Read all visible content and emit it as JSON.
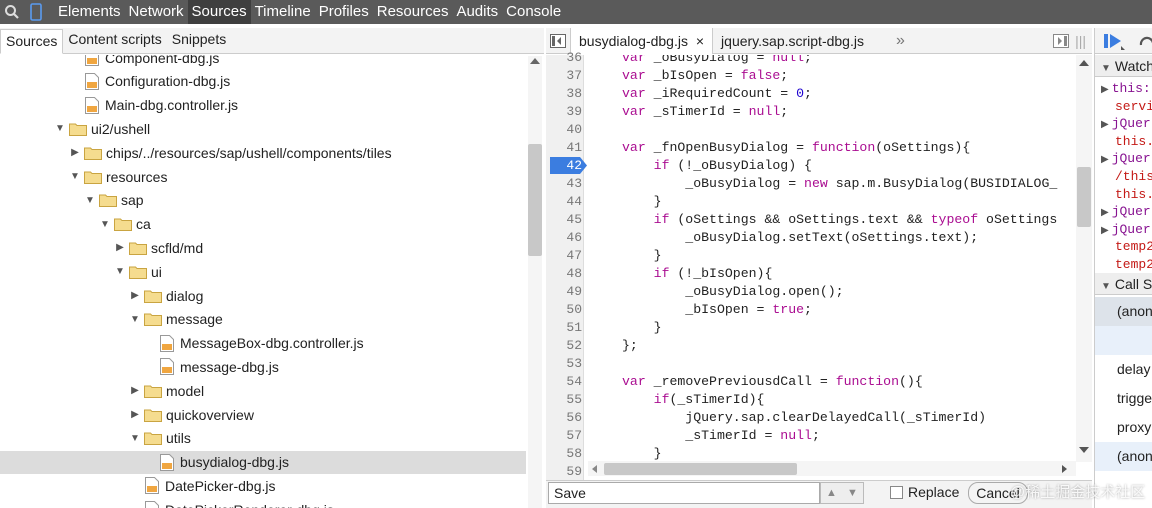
{
  "toolbar": {
    "search_icon": "magnifier-icon",
    "device_icon": "mobile-device-icon",
    "tabs": [
      "Elements",
      "Network",
      "Sources",
      "Timeline",
      "Profiles",
      "Resources",
      "Audits",
      "Console"
    ],
    "active_tab": "Sources"
  },
  "navigator": {
    "tabs": [
      "Sources",
      "Content scripts",
      "Snippets"
    ],
    "active_tab": "Sources",
    "tree": [
      {
        "label": "Component-dbg.js",
        "type": "file",
        "depth": 5
      },
      {
        "label": "Configuration-dbg.js",
        "type": "file",
        "depth": 5
      },
      {
        "label": "Main-dbg.controller.js",
        "type": "file",
        "depth": 5
      },
      {
        "label": "ui2/ushell",
        "type": "folder",
        "expanded": true,
        "depth": 3
      },
      {
        "label": "chips/../resources/sap/ushell/components/tiles",
        "type": "folder",
        "expanded": false,
        "depth": 4
      },
      {
        "label": "resources",
        "type": "folder",
        "expanded": true,
        "depth": 4
      },
      {
        "label": "sap",
        "type": "folder",
        "expanded": true,
        "depth": 5
      },
      {
        "label": "ca",
        "type": "folder",
        "expanded": true,
        "depth": 6
      },
      {
        "label": "scfld/md",
        "type": "folder",
        "expanded": false,
        "depth": 7
      },
      {
        "label": "ui",
        "type": "folder",
        "expanded": true,
        "depth": 7
      },
      {
        "label": "dialog",
        "type": "folder",
        "expanded": false,
        "depth": 8
      },
      {
        "label": "message",
        "type": "folder",
        "expanded": true,
        "depth": 8
      },
      {
        "label": "MessageBox-dbg.controller.js",
        "type": "file",
        "depth": 10
      },
      {
        "label": "message-dbg.js",
        "type": "file",
        "depth": 10
      },
      {
        "label": "model",
        "type": "folder",
        "expanded": false,
        "depth": 8
      },
      {
        "label": "quickoverview",
        "type": "folder",
        "expanded": false,
        "depth": 8
      },
      {
        "label": "utils",
        "type": "folder",
        "expanded": true,
        "depth": 8
      },
      {
        "label": "busydialog-dbg.js",
        "type": "file",
        "depth": 10,
        "selected": true
      },
      {
        "label": "DatePicker-dbg.js",
        "type": "file",
        "depth": 9
      },
      {
        "label": "DatePickerRenderer-dbg.js",
        "type": "file",
        "depth": 9
      }
    ]
  },
  "editor": {
    "tabs": [
      {
        "label": "busydialog-dbg.js",
        "active": true,
        "close": "×"
      },
      {
        "label": "jquery.sap.script-dbg.js",
        "active": false
      }
    ],
    "overflow_glyph": "»",
    "breakpoint_line": 42,
    "lines": [
      {
        "n": "36",
        "code": "var _oBusyDialog = null;"
      },
      {
        "n": "37",
        "code": "var _bIsOpen = false;"
      },
      {
        "n": "38",
        "code": "var _iRequiredCount = 0;"
      },
      {
        "n": "39",
        "code": "var _sTimerId = null;"
      },
      {
        "n": "40",
        "code": ""
      },
      {
        "n": "41",
        "code": "var _fnOpenBusyDialog = function(oSettings){"
      },
      {
        "n": "42",
        "code": "    if (!_oBusyDialog) {"
      },
      {
        "n": "43",
        "code": "        _oBusyDialog = new sap.m.BusyDialog(BUSIDIALOG_"
      },
      {
        "n": "44",
        "code": "    }"
      },
      {
        "n": "45",
        "code": "    if (oSettings && oSettings.text && typeof oSettings"
      },
      {
        "n": "46",
        "code": "        _oBusyDialog.setText(oSettings.text);"
      },
      {
        "n": "47",
        "code": "    }"
      },
      {
        "n": "48",
        "code": "    if (!_bIsOpen){"
      },
      {
        "n": "49",
        "code": "        _oBusyDialog.open();"
      },
      {
        "n": "50",
        "code": "        _bIsOpen = true;"
      },
      {
        "n": "51",
        "code": "    }"
      },
      {
        "n": "52",
        "code": "};"
      },
      {
        "n": "53",
        "code": ""
      },
      {
        "n": "54",
        "code": "var _removePreviousdCall = function(){"
      },
      {
        "n": "55",
        "code": "    if(_sTimerId){"
      },
      {
        "n": "56",
        "code": "        jQuery.sap.clearDelayedCall(_sTimerId)"
      },
      {
        "n": "57",
        "code": "        _sTimerId = null;"
      },
      {
        "n": "58",
        "code": "    }"
      },
      {
        "n": "59",
        "code": ""
      }
    ]
  },
  "search": {
    "value": "Save",
    "replace_label": "Replace",
    "cancel_label": "Cancel"
  },
  "debugger": {
    "watch_header": "Watch",
    "watch_lines": [
      {
        "text": "this:",
        "kind": "key",
        "arrow": true
      },
      {
        "text": "servi",
        "kind": "val",
        "arrow": false
      },
      {
        "text": "jQuer",
        "kind": "key",
        "arrow": true
      },
      {
        "text": "this.",
        "kind": "val",
        "arrow": false
      },
      {
        "text": "jQuer",
        "kind": "key",
        "arrow": true
      },
      {
        "text": "/this",
        "kind": "val",
        "arrow": false
      },
      {
        "text": "this.",
        "kind": "val",
        "arrow": false
      },
      {
        "text": "jQuer",
        "kind": "key",
        "arrow": true
      },
      {
        "text": "jQuer",
        "kind": "key",
        "arrow": true
      },
      {
        "text": "temp2",
        "kind": "val",
        "arrow": false
      },
      {
        "text": "temp2",
        "kind": "val",
        "arrow": false
      }
    ],
    "callstack_header": "Call S",
    "callstack": [
      {
        "label": "(anon",
        "style": "selected"
      },
      {
        "label": "",
        "style": "light"
      },
      {
        "label": "delay",
        "style": ""
      },
      {
        "label": "trigge",
        "style": ""
      },
      {
        "label": "proxy",
        "style": ""
      },
      {
        "label": "(anon",
        "style": "light"
      }
    ]
  },
  "watermark": "@稀土掘金技术社区",
  "colors": {
    "toolbar_bg": "#5a5a5a",
    "keyword": "#aa0d91",
    "number": "#1c00cf",
    "breakpoint": "#3b7de0",
    "folder": "#e8c46a"
  }
}
